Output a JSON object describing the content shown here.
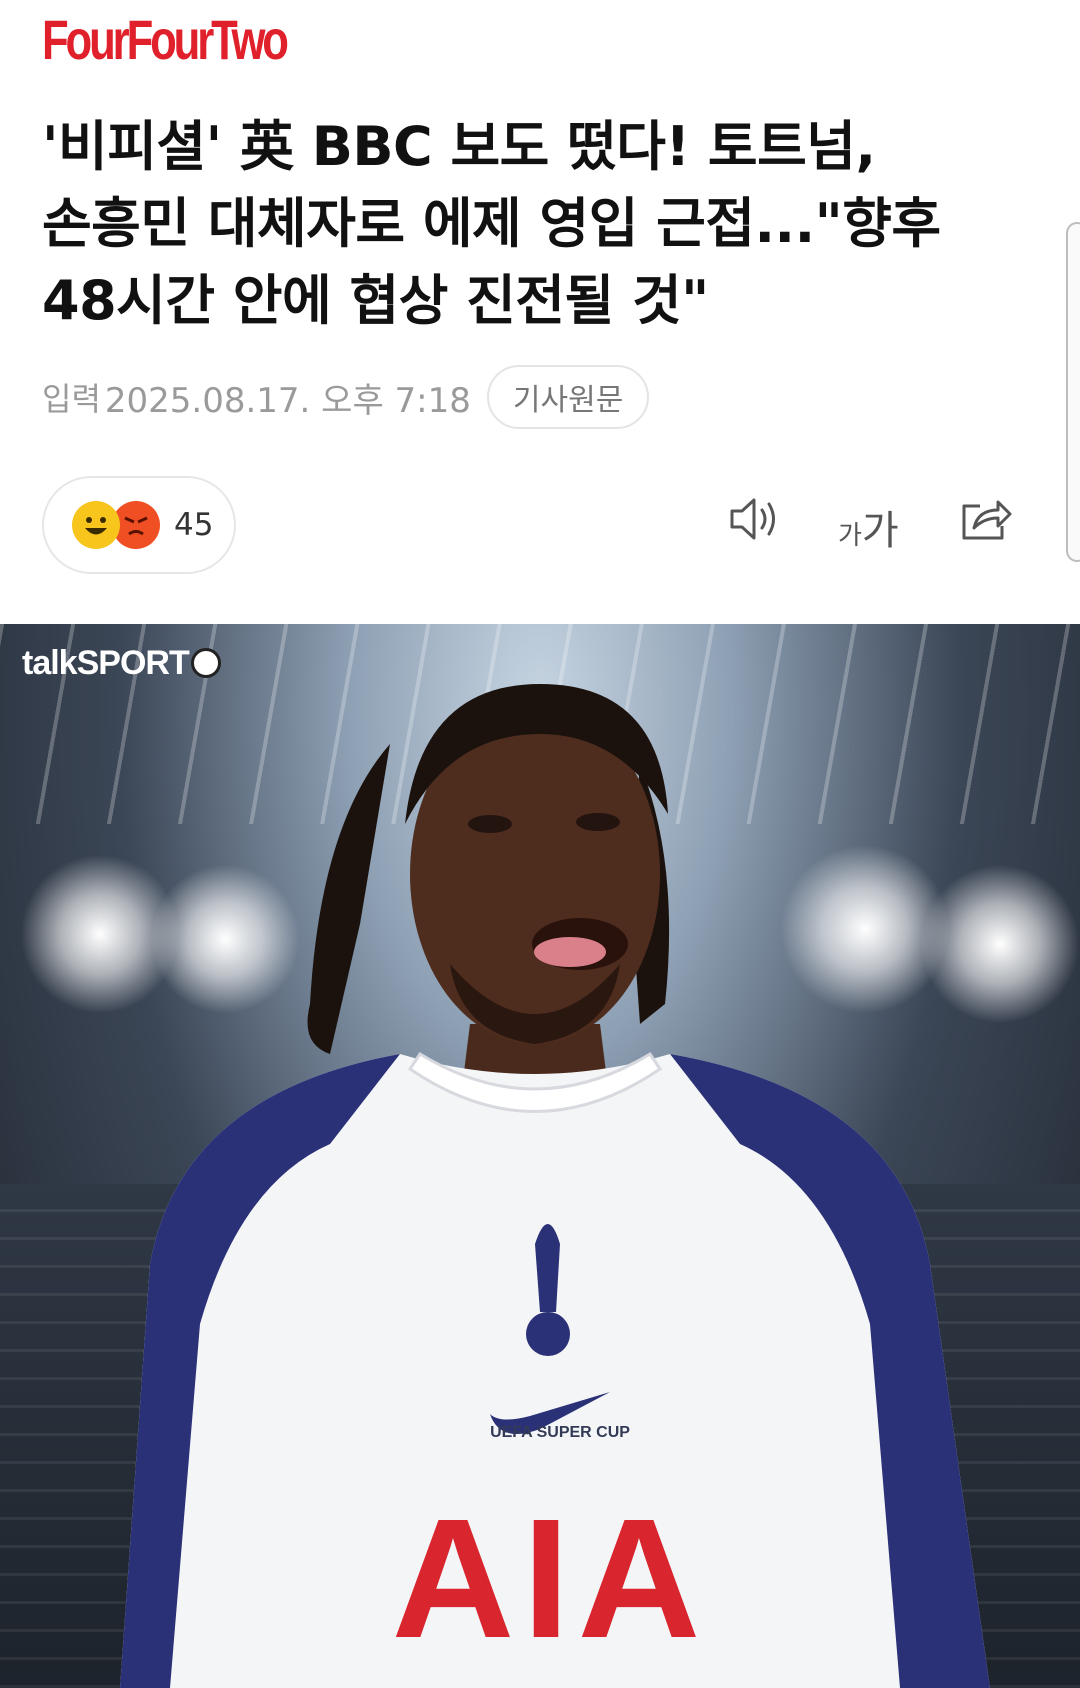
{
  "header": {
    "logo_text": "FourFourTwo",
    "brand_color": "#e0202a"
  },
  "article": {
    "headline": "'비피셜' 英 BBC 보도 떴다! 토트넘, 손흥민 대체자로 에제 영입 근접...\"향후 48시간 안에 협상 진전될 것\"",
    "meta_label": "입력",
    "meta_date": "2025.08.17. 오후 7:18",
    "source_button": "기사원문"
  },
  "reactions": {
    "icons": [
      "happy-emoji",
      "angry-emoji"
    ],
    "count": "45"
  },
  "toolbar": {
    "audio_icon": "speaker-icon",
    "font_small": "가",
    "font_big": "가",
    "share_icon": "share-icon"
  },
  "photo": {
    "watermark": "talkSPORT",
    "sponsor": "AIA",
    "cup_patch": "UEFA SUPER CUP"
  }
}
